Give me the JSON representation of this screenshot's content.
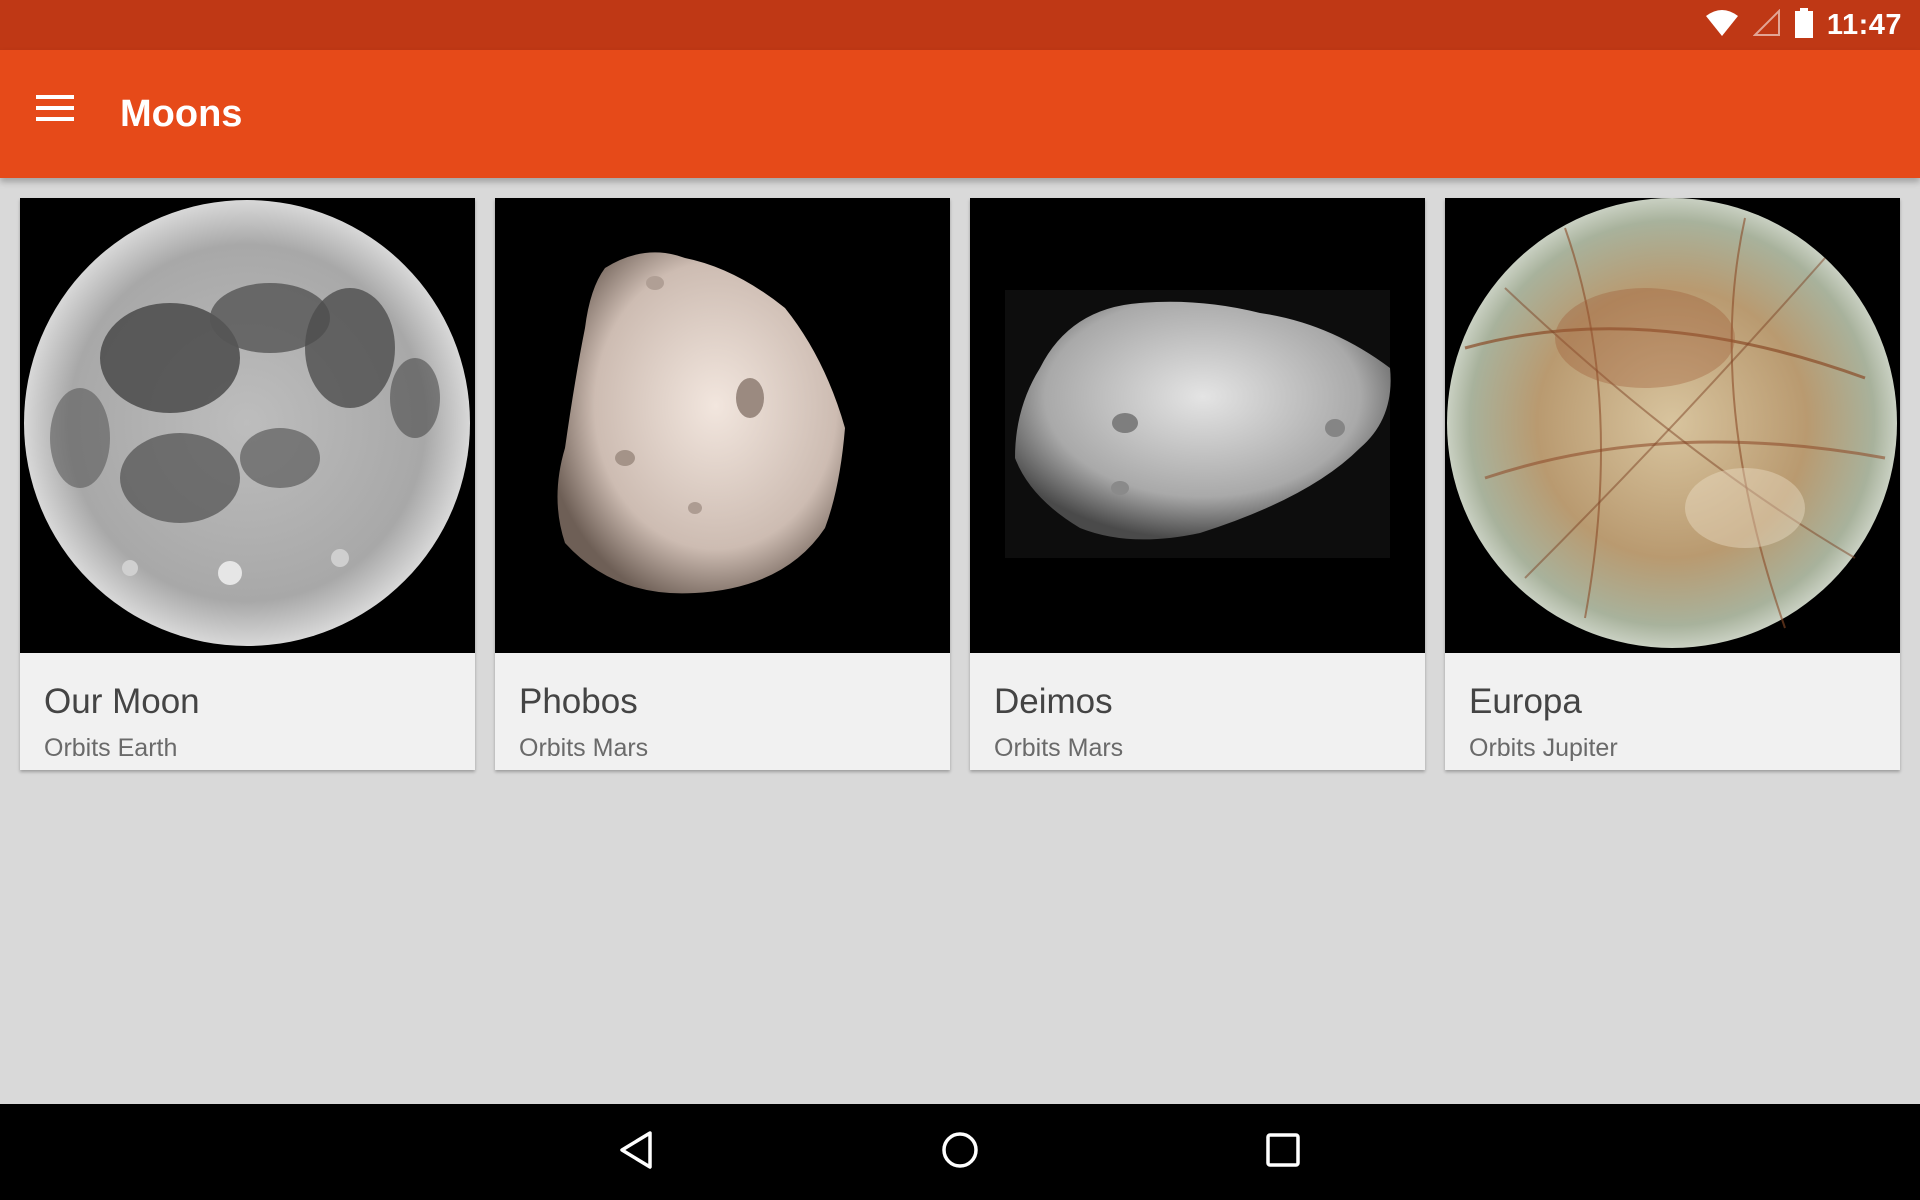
{
  "status_bar": {
    "time": "11:47",
    "icons": [
      "wifi-icon",
      "cell-signal-icon",
      "battery-icon"
    ]
  },
  "app_bar": {
    "title": "Moons",
    "menu_icon": "menu-icon"
  },
  "cards": [
    {
      "title": "Our Moon",
      "subtitle": "Orbits Earth"
    },
    {
      "title": "Phobos",
      "subtitle": "Orbits Mars"
    },
    {
      "title": "Deimos",
      "subtitle": "Orbits Mars"
    },
    {
      "title": "Europa",
      "subtitle": "Orbits Jupiter"
    }
  ],
  "nav_bar": {
    "icons": [
      "back-icon",
      "home-icon",
      "recents-icon"
    ]
  },
  "colors": {
    "status_bar": "#bf3815",
    "app_bar": "#e64a19",
    "background": "#d9d9d9",
    "card": "#f1f1f1"
  }
}
